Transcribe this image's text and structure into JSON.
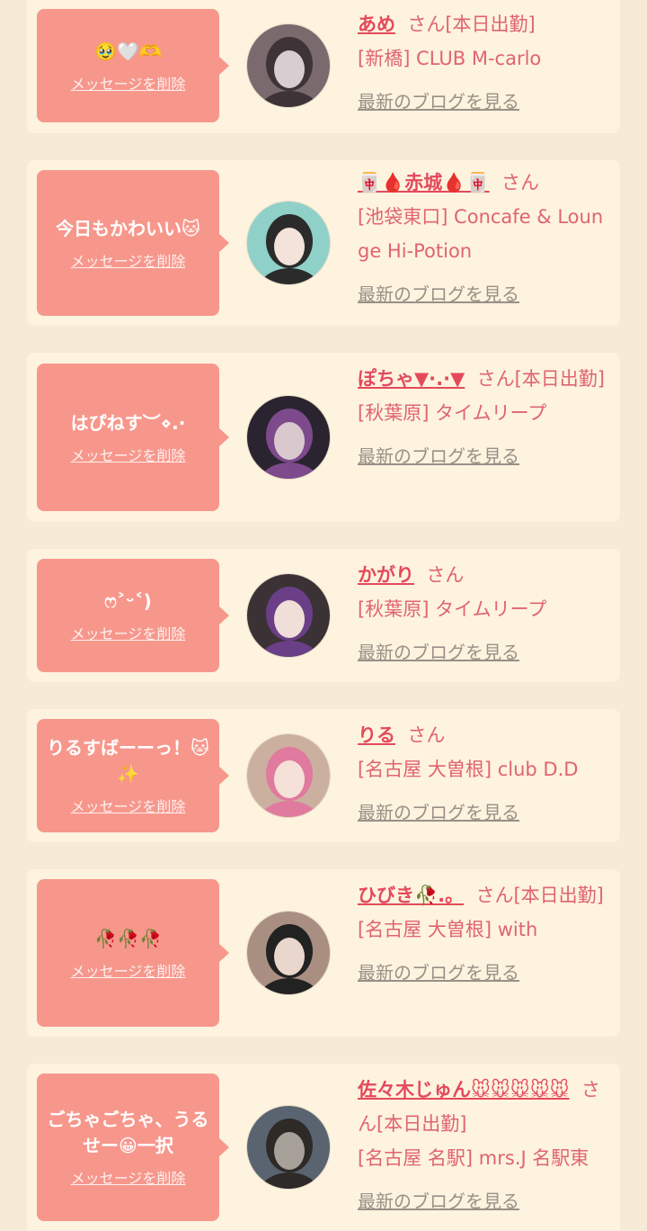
{
  "delete_label": "メッセージを削除",
  "blog_label": "最新のブログを見る",
  "items": [
    {
      "message": "🥹🤍🫶",
      "name": "あめ",
      "san": "さん[本日出勤]",
      "shop": "[新橋] CLUB M-carlo",
      "avatar_colors": [
        "#7a6a6e",
        "#d8cdd0",
        "#3e3438"
      ]
    },
    {
      "message": "今日もかわいい🐱",
      "name": "🀄🩸赤城🩸🀄",
      "san": "さん",
      "shop": "[池袋東口] Concafe & Lounge Hi-Potion",
      "avatar_colors": [
        "#8fd0c8",
        "#f3e3da",
        "#2b2b2b"
      ]
    },
    {
      "message": "はぴねす︶⋄.·",
      "name": "ぽちゃ▼·.·▼",
      "san": "さん[本日出勤]",
      "shop": "[秋葉原] タイムリープ",
      "avatar_colors": [
        "#2a2430",
        "#d9c9cf",
        "#7d4a8c"
      ]
    },
    {
      "message": "ෆ˃ᵕ˂)",
      "name": "かがり",
      "san": "さん",
      "shop": "[秋葉原] タイムリープ",
      "avatar_colors": [
        "#3a3235",
        "#f0dfd8",
        "#6b3f87"
      ]
    },
    {
      "message": "りるすばーーっ！🐱✨",
      "name": "りる",
      "san": "さん",
      "shop": "[名古屋 大曽根] club D.D",
      "avatar_colors": [
        "#cbb0a0",
        "#f5e1d8",
        "#e07a9e"
      ]
    },
    {
      "message": "🥀🥀🥀",
      "name": "ひびき🥀.。",
      "san": "さん[本日出勤]",
      "shop": "[名古屋 大曽根] with",
      "avatar_colors": [
        "#a98f82",
        "#e9d6cc",
        "#222222"
      ]
    },
    {
      "message": "ごちゃごちゃ、うるせー😀一択",
      "name": "佐々木じゅん🐭🐭🐭🐭🐭",
      "san": "さん[本日出勤]",
      "shop": "[名古屋 名駅] mrs.J 名駅東",
      "avatar_colors": [
        "#5a6470",
        "#a7a19a",
        "#2e2a28"
      ]
    }
  ]
}
